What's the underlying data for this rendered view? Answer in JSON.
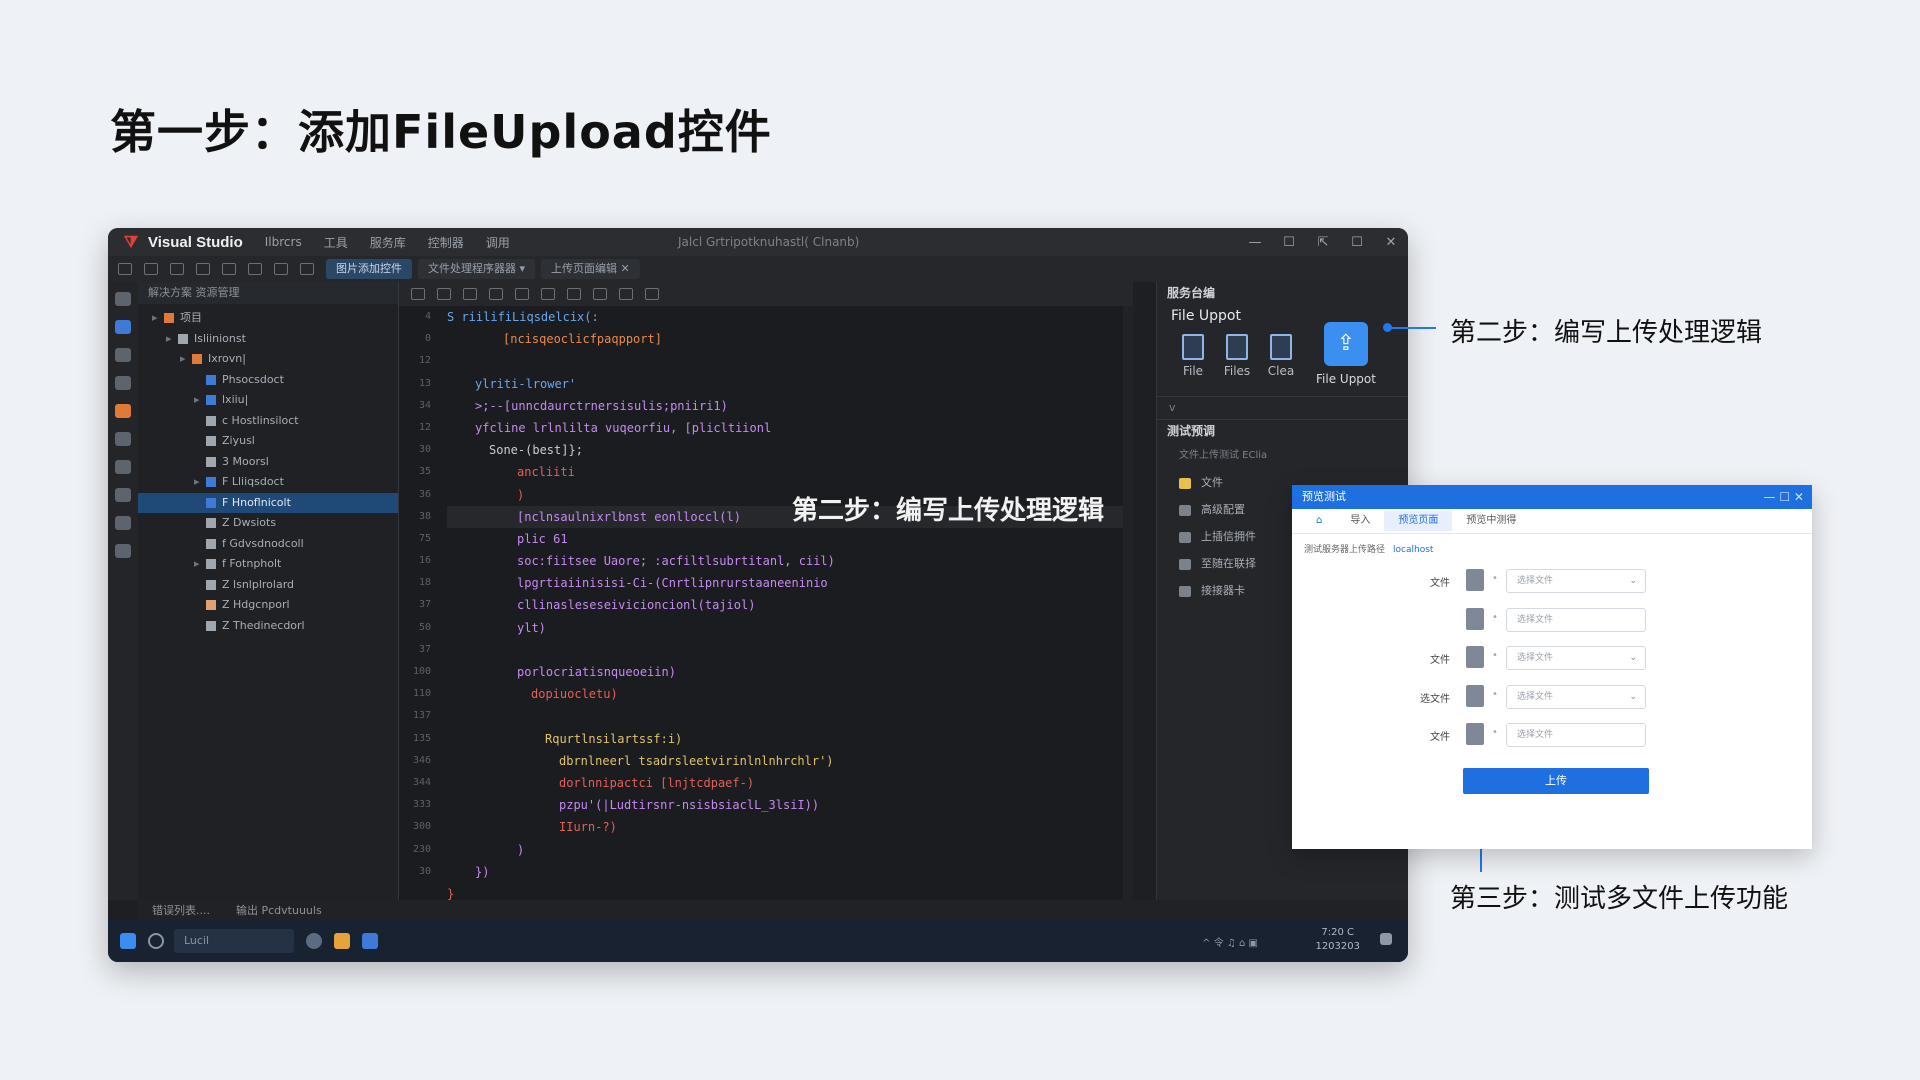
{
  "page": {
    "title": "第一步：添加FileUpload控件"
  },
  "vs": {
    "app_name": "Visual Studio",
    "menu": [
      "Ilbrcrs",
      "工具",
      "服务库",
      "控制器",
      "调用"
    ],
    "window_title": "Jalcl Grtripotknuhastl( Clnanb)",
    "win_controls": [
      "—",
      "☐",
      "⇱",
      "☐",
      "✕"
    ],
    "doc_tabs": [
      "图片添加控件",
      "文件处理程序器器 ▾",
      "上传页面编辑 ✕"
    ],
    "explorer_header": "解决方案 资源管理",
    "tree": [
      {
        "label": "项目",
        "indent": 0
      },
      {
        "label": "Isliinionst",
        "indent": 1
      },
      {
        "label": "Ixrovn|",
        "indent": 2
      },
      {
        "label": "Phsocsdoct",
        "indent": 3
      },
      {
        "label": "lxiiu|",
        "indent": 3
      },
      {
        "label": "c Hostlinsiloct",
        "indent": 3
      },
      {
        "label": "Ziyusl",
        "indent": 3
      },
      {
        "label": "3 Moorsl",
        "indent": 3
      },
      {
        "label": "F Lliiqsdoct",
        "indent": 3
      },
      {
        "label": "F Hnoflnicolt",
        "indent": 3,
        "selected": true
      },
      {
        "label": "Z Dwsiots",
        "indent": 3
      },
      {
        "label": "f Gdvsdnodcoll",
        "indent": 3
      },
      {
        "label": "f Fotnpholt",
        "indent": 3
      },
      {
        "label": "Z lsnlplrolard",
        "indent": 3
      },
      {
        "label": "Z Hdgcnporl",
        "indent": 3
      },
      {
        "label": "Z Thedinecdorl",
        "indent": 3
      }
    ],
    "line_numbers": [
      "4",
      "0",
      "12",
      "13",
      "34",
      "12",
      "30",
      "35",
      "36",
      "38",
      "75",
      "16",
      "18",
      "37",
      "50",
      "37",
      "100",
      "110",
      "137",
      "135",
      "346",
      "344",
      "333",
      "300",
      "230",
      "30"
    ],
    "code": [
      {
        "text": "S riilifiLiqsdelcix(:",
        "cls": "c-blue",
        "indent": 0
      },
      {
        "text": "[ncisqeoclicfpaqpport]",
        "cls": "c-orange",
        "indent": 4
      },
      {
        "text": "",
        "cls": "c-white",
        "indent": 0
      },
      {
        "text": "ylriti-lrower'",
        "cls": "c-blue",
        "indent": 2
      },
      {
        "text": ">;--[unncdaurctrnersisulis;pniiri1)",
        "cls": "c-purple",
        "indent": 2
      },
      {
        "text": "yfcline lrlnlilta vuqeorfiu, [plicltiionl",
        "cls": "c-purple",
        "indent": 2
      },
      {
        "text": "Sone-(best]};",
        "cls": "c-white",
        "indent": 3
      },
      {
        "text": "ancliiti",
        "cls": "c-red",
        "indent": 5
      },
      {
        "text": ")",
        "cls": "c-red",
        "indent": 5
      },
      {
        "text": "[nclnsaulnixrlbnst eonlloccl(l)",
        "cls": "c-purple",
        "indent": 5,
        "highlight": true
      },
      {
        "text": "plic 61",
        "cls": "c-purple",
        "indent": 5
      },
      {
        "text": "soc:fiitsee Uaore; :acfiltlsubrtitanl, ciil)",
        "cls": "c-purple",
        "indent": 5
      },
      {
        "text": "lpgrtiaiinisisi-Ci-(Cnrtlipnrurstaaneeninio",
        "cls": "c-purple",
        "indent": 5
      },
      {
        "text": "cllinasleseseivicioncionl(tajiol)",
        "cls": "c-purple",
        "indent": 5
      },
      {
        "text": "ylt)",
        "cls": "c-purple",
        "indent": 5
      },
      {
        "text": "",
        "cls": "c-white",
        "indent": 0
      },
      {
        "text": "porlocriatisnqueoeiin)",
        "cls": "c-purple",
        "indent": 5
      },
      {
        "text": "dopiuocletu)",
        "cls": "c-red",
        "indent": 6
      },
      {
        "text": "",
        "cls": "c-white",
        "indent": 0
      },
      {
        "text": "Rqurtlnsilartssf:i)",
        "cls": "c-yellow",
        "indent": 7
      },
      {
        "text": "dbrnlneerl tsadrsleetvirinlnlnhrchlr')",
        "cls": "c-yellow",
        "indent": 8
      },
      {
        "text": "dorlnnipactci [lnjtcdpaef-)",
        "cls": "c-red",
        "indent": 8
      },
      {
        "text": "pzpu'(|Ludtirsnr-nsisbsiaclL_3lsiI))",
        "cls": "c-purple",
        "indent": 8
      },
      {
        "text": "IIurn-?)",
        "cls": "c-red",
        "indent": 8
      },
      {
        "text": ")",
        "cls": "c-purple",
        "indent": 5
      },
      {
        "text": "})",
        "cls": "c-purple",
        "indent": 2
      },
      {
        "text": "}",
        "cls": "c-red",
        "indent": 0
      }
    ],
    "editor_callout": "第二步：编写上传处理逻辑",
    "right_panel": {
      "header": "服务台编",
      "subtitle": "File Uppot",
      "tools": [
        "File",
        "Files",
        "Clea"
      ],
      "featured_tool": "File Uppot",
      "featured_icon": "upload-user-icon",
      "separator": "v",
      "section": "测试预调",
      "section_hint": "文件上传测试 EClia",
      "items": [
        "文件",
        "高级配置",
        "上插信拥件",
        "至随在联择",
        "接接器卡"
      ]
    },
    "bottom_tabs": [
      "错误列表....",
      "输出 Pcdvtuuuls"
    ],
    "taskbar": {
      "search": "Lucil",
      "tray": "^ 令 ♫ ⌂ ▣",
      "time": "7:20 C",
      "date": "1203203"
    }
  },
  "callouts": {
    "step2": "第二步：编写上传处理逻辑",
    "step3": "第三步：测试多文件上传功能"
  },
  "dialog": {
    "title": "预览测试",
    "controls": "—  ☐  ✕",
    "tabs": [
      "导入",
      "预览页面",
      "预览中测得"
    ],
    "hint": "测试服务器上传路径",
    "hint_link": "localhost",
    "rows": [
      {
        "label": "文件",
        "placeholder": "选择文件",
        "dropdown": true
      },
      {
        "label": "",
        "placeholder": "选择文件",
        "dropdown": false
      },
      {
        "label": "文件",
        "placeholder": "选择文件",
        "dropdown": true
      },
      {
        "label": "选文件",
        "placeholder": "选择文件",
        "dropdown": true
      },
      {
        "label": "文件",
        "placeholder": "选择文件",
        "dropdown": false
      }
    ],
    "submit": "上传"
  },
  "colors": {
    "accent": "#1e6fe0",
    "callout": "#1e78f0",
    "vs_logo": "#e0403a"
  }
}
